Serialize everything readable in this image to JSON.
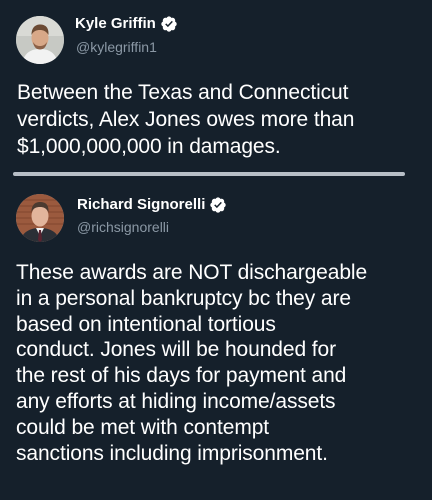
{
  "colors": {
    "background": "#15202b",
    "text": "#ffffff",
    "secondary_text": "#8b98a5",
    "divider": "#b7bec6",
    "verified_badge": "#ffffff"
  },
  "tweets": [
    {
      "display_name": "Kyle Griffin",
      "verified": true,
      "verified_icon": "verified-badge-icon",
      "handle": "@kylegriffin1",
      "text": "Between the Texas and Connecticut\nverdicts, Alex Jones owes more than\n$1,000,000,000 in damages."
    },
    {
      "display_name": "Richard Signorelli",
      "verified": true,
      "verified_icon": "verified-badge-icon",
      "handle": "@richsignorelli",
      "text": "These awards are NOT dischargeable\nin a personal bankruptcy bc they are\nbased on intentional tortious\nconduct.  Jones will be hounded for\nthe rest of his days for payment and\nany efforts at hiding income/assets\ncould be met with contempt\nsanctions including imprisonment."
    }
  ]
}
